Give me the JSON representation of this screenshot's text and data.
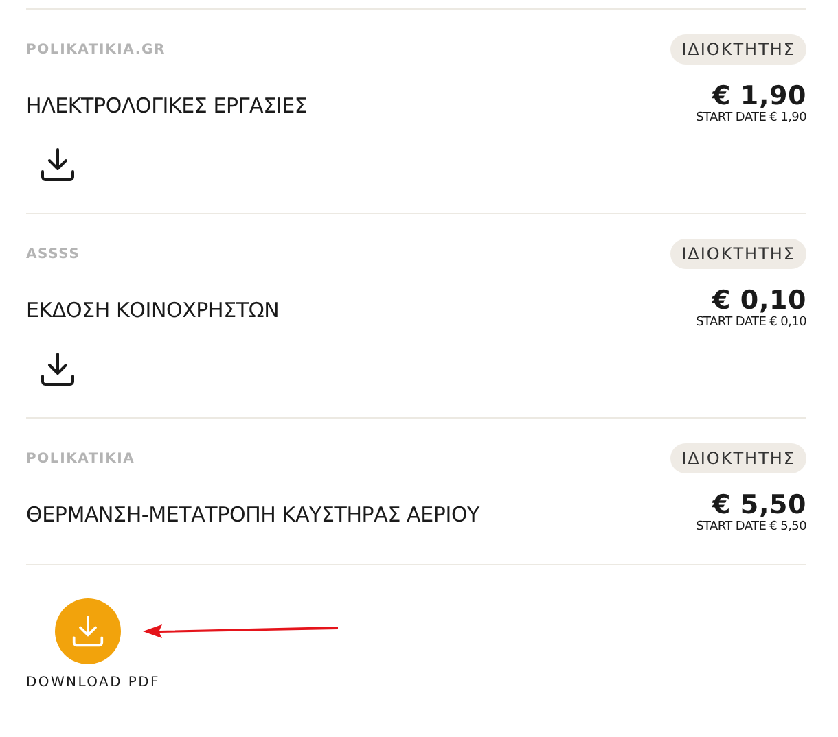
{
  "items": [
    {
      "kind": "with-download",
      "source": "POLIKATIKIA.GR",
      "role": "ΙΔΙΟΚΤΗΤΗΣ",
      "title": "ΗΛΕΚΤΡΟΛΟΓΙΚΕΣ ΕΡΓΑΣΙΕΣ",
      "amount": "€ 1,90",
      "start_date": "START DATE € 1,90"
    },
    {
      "kind": "with-download",
      "source": "ASSSS",
      "role": "ΙΔΙΟΚΤΗΤΗΣ",
      "title": "ΕΚΔΟΣΗ ΚΟΙΝΟΧΡΗΣΤΩΝ",
      "amount": "€ 0,10",
      "start_date": "START DATE € 0,10"
    },
    {
      "kind": "plain",
      "source": "POLIKATIKIA",
      "role": "ΙΔΙΟΚΤΗΤΗΣ",
      "title": "ΘΕΡΜΑΝΣΗ-ΜΕΤΑΤΡΟΠΗ ΚΑΥΣΤΗΡΑΣ ΑΕΡΙΟΥ",
      "amount": "€ 5,50",
      "start_date": "START DATE € 5,50"
    }
  ],
  "download_pdf": {
    "label": "DOWNLOAD PDF"
  }
}
